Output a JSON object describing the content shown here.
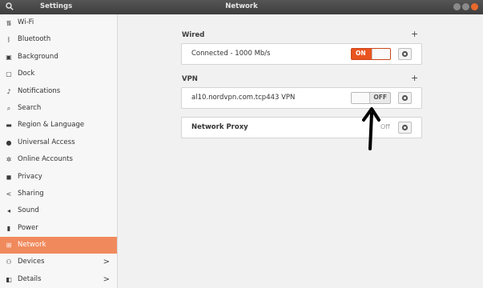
{
  "titlebar": {
    "search_icon": "search-icon",
    "app_title": "Settings",
    "panel_title": "Network",
    "window_controls": [
      "minimize",
      "maximize",
      "close"
    ]
  },
  "sidebar": {
    "items": [
      {
        "label": "Wi-Fi",
        "icon": "wifi-icon"
      },
      {
        "label": "Bluetooth",
        "icon": "bluetooth-icon"
      },
      {
        "label": "Background",
        "icon": "background-icon"
      },
      {
        "label": "Dock",
        "icon": "dock-icon"
      },
      {
        "label": "Notifications",
        "icon": "bell-icon"
      },
      {
        "label": "Search",
        "icon": "search-icon"
      },
      {
        "label": "Region & Language",
        "icon": "keyboard-icon"
      },
      {
        "label": "Universal Access",
        "icon": "accessibility-icon"
      },
      {
        "label": "Online Accounts",
        "icon": "accounts-icon"
      },
      {
        "label": "Privacy",
        "icon": "privacy-icon"
      },
      {
        "label": "Sharing",
        "icon": "share-icon"
      },
      {
        "label": "Sound",
        "icon": "speaker-icon"
      },
      {
        "label": "Power",
        "icon": "power-icon"
      },
      {
        "label": "Network",
        "icon": "network-icon",
        "active": true
      },
      {
        "label": "Devices",
        "icon": "devices-icon",
        "chevron": ">"
      },
      {
        "label": "Details",
        "icon": "details-icon",
        "chevron": ">"
      }
    ]
  },
  "wired": {
    "title": "Wired",
    "add_label": "+",
    "connection_label": "Connected - 1000 Mb/s",
    "toggle_label": "ON"
  },
  "vpn": {
    "title": "VPN",
    "add_label": "+",
    "connection_label": "al10.nordvpn.com.tcp443 VPN",
    "toggle_label": "OFF"
  },
  "proxy": {
    "label": "Network Proxy",
    "status": "Off"
  },
  "colors": {
    "accent": "#e95420",
    "active_sidebar": "#f08a5d",
    "titlebar": "#474747"
  }
}
